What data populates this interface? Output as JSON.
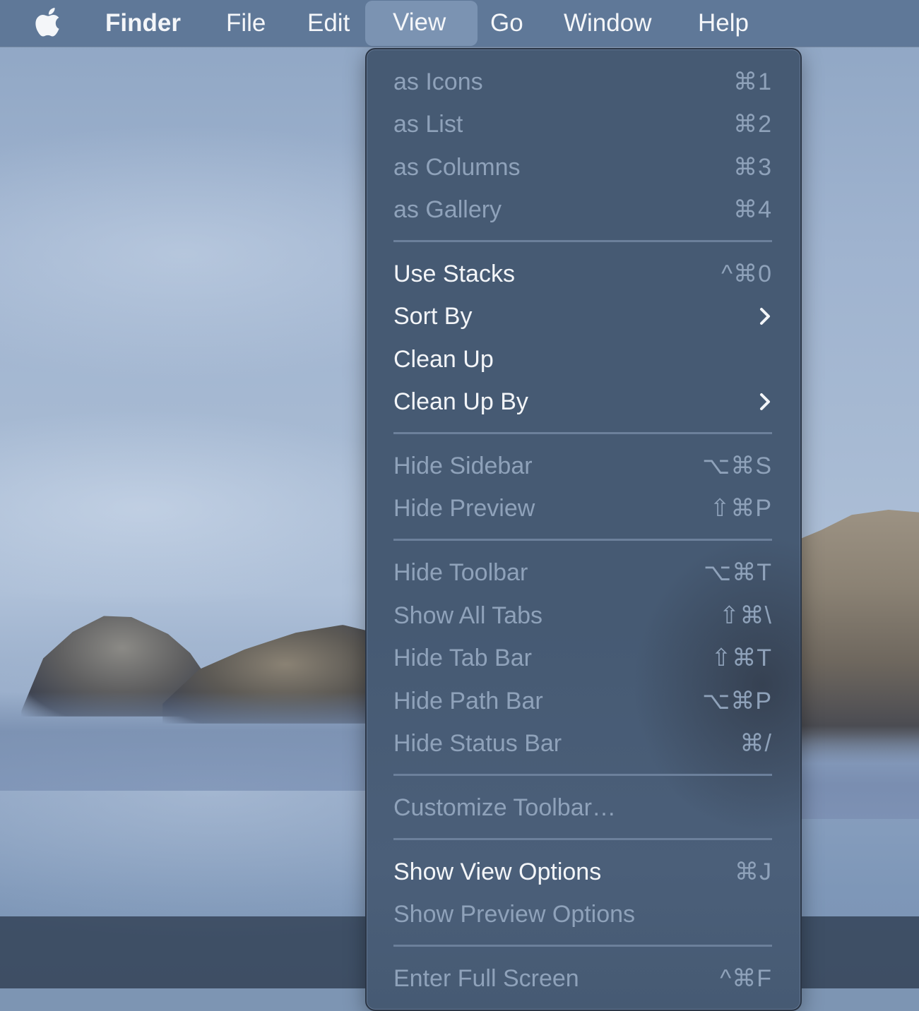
{
  "menubar": {
    "apple_icon": "apple-logo",
    "items": [
      {
        "label": "Finder",
        "app": true
      },
      {
        "label": "File"
      },
      {
        "label": "Edit"
      },
      {
        "label": "View",
        "active": true
      },
      {
        "label": "Go"
      },
      {
        "label": "Window"
      },
      {
        "label": "Help"
      }
    ]
  },
  "view_menu": {
    "groups": [
      [
        {
          "label": "as Icons",
          "shortcut": "⌘1",
          "enabled": false
        },
        {
          "label": "as List",
          "shortcut": "⌘2",
          "enabled": false
        },
        {
          "label": "as Columns",
          "shortcut": "⌘3",
          "enabled": false
        },
        {
          "label": "as Gallery",
          "shortcut": "⌘4",
          "enabled": false
        }
      ],
      [
        {
          "label": "Use Stacks",
          "shortcut": "^⌘0",
          "enabled": true
        },
        {
          "label": "Sort By",
          "submenu": true,
          "enabled": true
        },
        {
          "label": "Clean Up",
          "enabled": true
        },
        {
          "label": "Clean Up By",
          "submenu": true,
          "enabled": true
        }
      ],
      [
        {
          "label": "Hide Sidebar",
          "shortcut": "⌥⌘S",
          "enabled": false
        },
        {
          "label": "Hide Preview",
          "shortcut": "⇧⌘P",
          "enabled": false
        }
      ],
      [
        {
          "label": "Hide Toolbar",
          "shortcut": "⌥⌘T",
          "enabled": false
        },
        {
          "label": "Show All Tabs",
          "shortcut": "⇧⌘\\",
          "enabled": false
        },
        {
          "label": "Hide Tab Bar",
          "shortcut": "⇧⌘T",
          "enabled": false
        },
        {
          "label": "Hide Path Bar",
          "shortcut": "⌥⌘P",
          "enabled": false
        },
        {
          "label": "Hide Status Bar",
          "shortcut": "⌘/",
          "enabled": false
        }
      ],
      [
        {
          "label": "Customize Toolbar…",
          "enabled": false
        }
      ],
      [
        {
          "label": "Show View Options",
          "shortcut": "⌘J",
          "enabled": true
        },
        {
          "label": "Show Preview Options",
          "enabled": false
        }
      ],
      [
        {
          "label": "Enter Full Screen",
          "shortcut": "^⌘F",
          "enabled": false
        }
      ]
    ]
  },
  "colors": {
    "menubar_bg": "#5f7898",
    "menubar_active": "#7b93b2",
    "menu_bg": "#465a73",
    "enabled_text": "#f3f5f8",
    "disabled_text": "#8fa2ba"
  }
}
